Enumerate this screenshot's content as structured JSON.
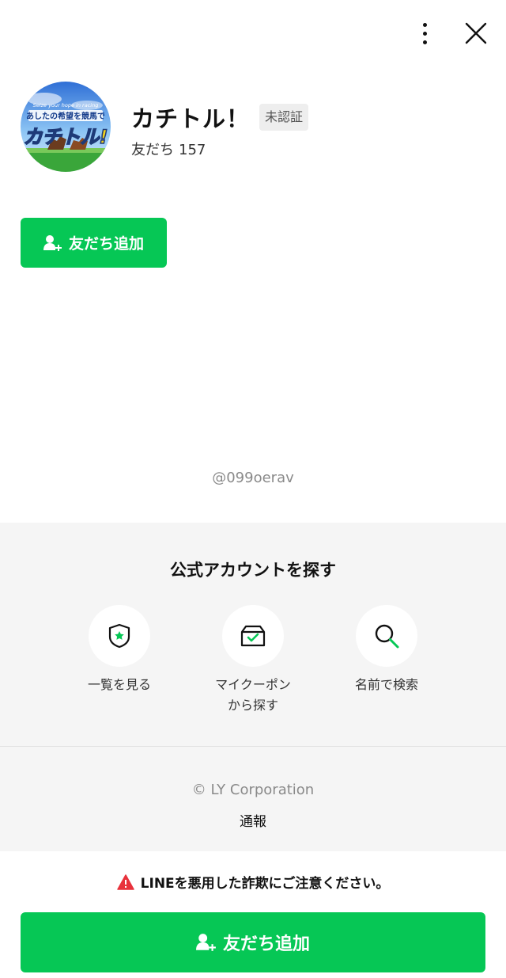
{
  "header": {
    "menu_icon": "more-vertical-icon",
    "close_icon": "close-icon"
  },
  "profile": {
    "name": "カチトル！",
    "badge": "未認証",
    "friends_label": "友だち",
    "friends_count": "157",
    "avatar": {
      "tagline": "Seize your hope in racing",
      "subtitle": "あしたの希望を競馬で",
      "logo": "カチトル!"
    }
  },
  "add_friend_top": {
    "label": "友だち追加",
    "icon": "add-friend-icon"
  },
  "account_id": "@099oerav",
  "explore": {
    "title": "公式アカウントを探す",
    "items": [
      {
        "label": "一覧を見る",
        "icon": "shield-star-icon"
      },
      {
        "label_line1": "マイクーポン",
        "label_line2": "から探す",
        "icon": "coupon-box-icon"
      },
      {
        "label": "名前で検索",
        "icon": "search-icon"
      }
    ]
  },
  "footer": {
    "copyright": "© LY Corporation",
    "report": "通報"
  },
  "warning": {
    "text": "LINEを悪用した詐欺にご注意ください。",
    "icon": "warning-icon"
  },
  "add_friend_bottom": {
    "label": "友だち追加",
    "icon": "add-friend-icon"
  },
  "colors": {
    "accent": "#06c755",
    "panel": "#f5f5f5",
    "warning": "#e8323c"
  }
}
